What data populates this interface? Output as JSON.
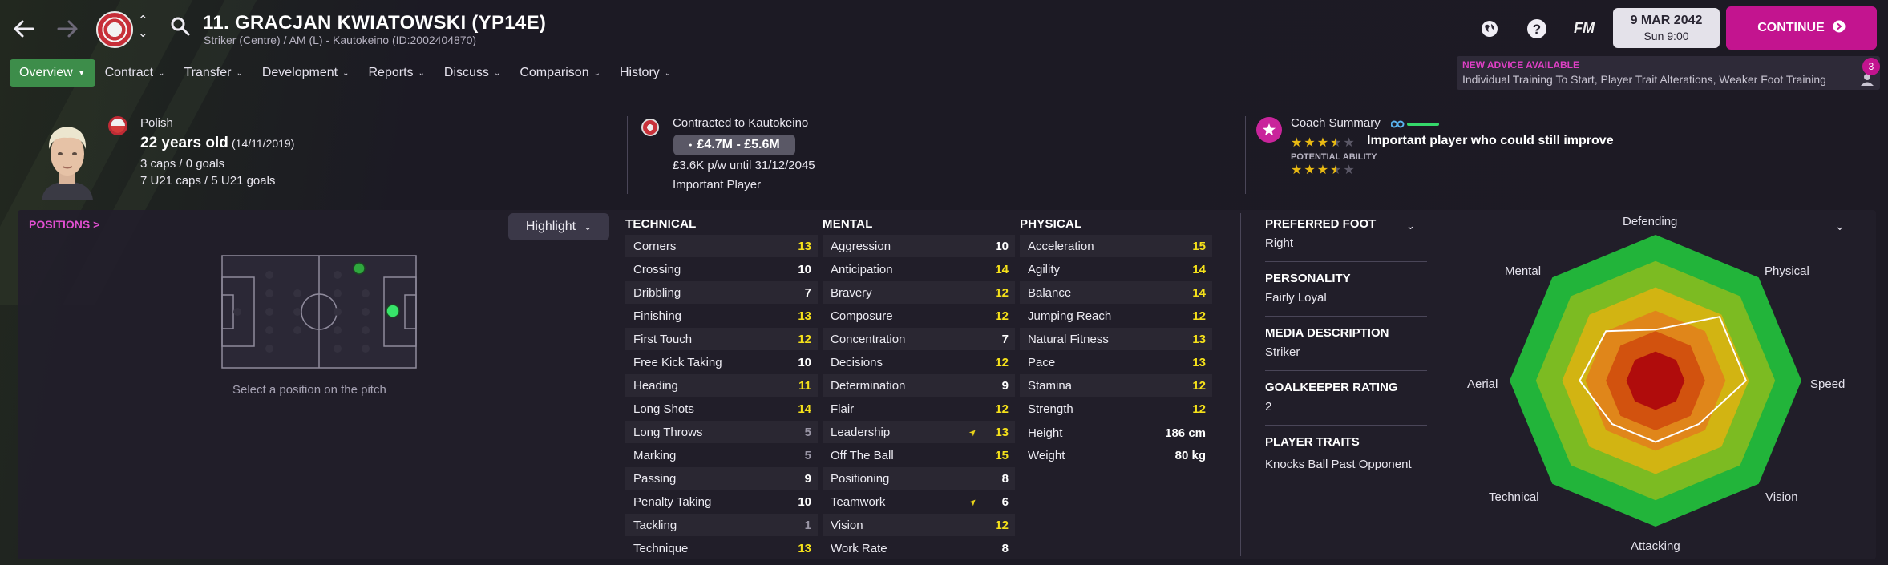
{
  "header": {
    "player_name": "11. GRACJAN KWIATOWSKI (YP14E)",
    "player_sub": "Striker (Centre) / AM (L) - Kautokeino (ID:2002404870)",
    "fm_label": "FM",
    "date_main": "9 MAR 2042",
    "date_sub": "Sun 9:00",
    "continue_label": "CONTINUE",
    "icons": [
      "back-arrow-icon",
      "forward-arrow-icon",
      "club-crest-icon",
      "up-down-arrows-icon",
      "search-icon",
      "world-globe-icon",
      "help-icon"
    ]
  },
  "tabs": [
    {
      "label": "Overview",
      "active": true
    },
    {
      "label": "Contract"
    },
    {
      "label": "Transfer"
    },
    {
      "label": "Development"
    },
    {
      "label": "Reports"
    },
    {
      "label": "Discuss"
    },
    {
      "label": "Comparison"
    },
    {
      "label": "History"
    }
  ],
  "advice": {
    "title": "NEW ADVICE AVAILABLE",
    "text": "Individual Training To Start, Player Trait Alterations, Weaker Foot Training",
    "count": "3"
  },
  "summary": {
    "nationality": "Polish",
    "age": "22 years old",
    "dob": "(14/11/2019)",
    "caps": "3 caps / 0 goals",
    "u21": "7 U21 caps / 5 U21 goals",
    "contract_to": "Contracted to Kautokeino",
    "value": "£4.7M - £5.6M",
    "wage": "£3.6K p/w until 31/12/2045",
    "status": "Important Player",
    "coach_label": "Coach Summary",
    "coach_text": "Important player who could still improve",
    "potential_label": "POTENTIAL ABILITY",
    "current_stars": 3.5,
    "potential_stars": 3.5
  },
  "positions": {
    "link": "POSITIONS >",
    "highlight": "Highlight",
    "hint": "Select a position on the pitch"
  },
  "technical": {
    "title": "TECHNICAL",
    "rows": [
      {
        "name": "Corners",
        "value": "13",
        "color": "yellow"
      },
      {
        "name": "Crossing",
        "value": "10",
        "color": "white"
      },
      {
        "name": "Dribbling",
        "value": "7",
        "color": "white"
      },
      {
        "name": "Finishing",
        "value": "13",
        "color": "yellow"
      },
      {
        "name": "First Touch",
        "value": "12",
        "color": "yellow"
      },
      {
        "name": "Free Kick Taking",
        "value": "10",
        "color": "white"
      },
      {
        "name": "Heading",
        "value": "11",
        "color": "yellow"
      },
      {
        "name": "Long Shots",
        "value": "14",
        "color": "yellow"
      },
      {
        "name": "Long Throws",
        "value": "5",
        "color": "grey"
      },
      {
        "name": "Marking",
        "value": "5",
        "color": "grey"
      },
      {
        "name": "Passing",
        "value": "9",
        "color": "white"
      },
      {
        "name": "Penalty Taking",
        "value": "10",
        "color": "white"
      },
      {
        "name": "Tackling",
        "value": "1",
        "color": "grey"
      },
      {
        "name": "Technique",
        "value": "13",
        "color": "yellow"
      }
    ]
  },
  "mental": {
    "title": "MENTAL",
    "rows": [
      {
        "name": "Aggression",
        "value": "10",
        "color": "white"
      },
      {
        "name": "Anticipation",
        "value": "14",
        "color": "yellow"
      },
      {
        "name": "Bravery",
        "value": "12",
        "color": "yellow"
      },
      {
        "name": "Composure",
        "value": "12",
        "color": "yellow"
      },
      {
        "name": "Concentration",
        "value": "7",
        "color": "white"
      },
      {
        "name": "Decisions",
        "value": "12",
        "color": "yellow"
      },
      {
        "name": "Determination",
        "value": "9",
        "color": "white"
      },
      {
        "name": "Flair",
        "value": "12",
        "color": "yellow"
      },
      {
        "name": "Leadership",
        "value": "13",
        "color": "yellow",
        "arrow": true
      },
      {
        "name": "Off The Ball",
        "value": "15",
        "color": "yellow"
      },
      {
        "name": "Positioning",
        "value": "8",
        "color": "white"
      },
      {
        "name": "Teamwork",
        "value": "6",
        "color": "white",
        "arrow": true
      },
      {
        "name": "Vision",
        "value": "12",
        "color": "yellow"
      },
      {
        "name": "Work Rate",
        "value": "8",
        "color": "white"
      }
    ]
  },
  "physical": {
    "title": "PHYSICAL",
    "rows": [
      {
        "name": "Acceleration",
        "value": "15",
        "color": "yellow"
      },
      {
        "name": "Agility",
        "value": "14",
        "color": "yellow"
      },
      {
        "name": "Balance",
        "value": "14",
        "color": "yellow"
      },
      {
        "name": "Jumping Reach",
        "value": "12",
        "color": "yellow"
      },
      {
        "name": "Natural Fitness",
        "value": "13",
        "color": "yellow"
      },
      {
        "name": "Pace",
        "value": "13",
        "color": "yellow"
      },
      {
        "name": "Stamina",
        "value": "12",
        "color": "yellow"
      },
      {
        "name": "Strength",
        "value": "12",
        "color": "yellow"
      }
    ],
    "height_label": "Height",
    "height_value": "186 cm",
    "weight_label": "Weight",
    "weight_value": "80 kg"
  },
  "details": {
    "preferred_foot_label": "PREFERRED FOOT",
    "preferred_foot": "Right",
    "personality_label": "PERSONALITY",
    "personality": "Fairly Loyal",
    "media_label": "MEDIA DESCRIPTION",
    "media": "Striker",
    "gk_label": "GOALKEEPER RATING",
    "gk": "2",
    "traits_label": "PLAYER TRAITS",
    "traits": "Knocks Ball Past Opponent"
  },
  "radar": {
    "labels": [
      "Defending",
      "Physical",
      "Speed",
      "Vision",
      "Attacking",
      "Technical",
      "Aerial",
      "Mental"
    ],
    "values": [
      0.35,
      0.62,
      0.62,
      0.42,
      0.42,
      0.42,
      0.52,
      0.48
    ],
    "colors": [
      "#22b43a",
      "#7cbb22",
      "#d2b412",
      "#e0861a",
      "#d2520e",
      "#b00c0c"
    ]
  }
}
